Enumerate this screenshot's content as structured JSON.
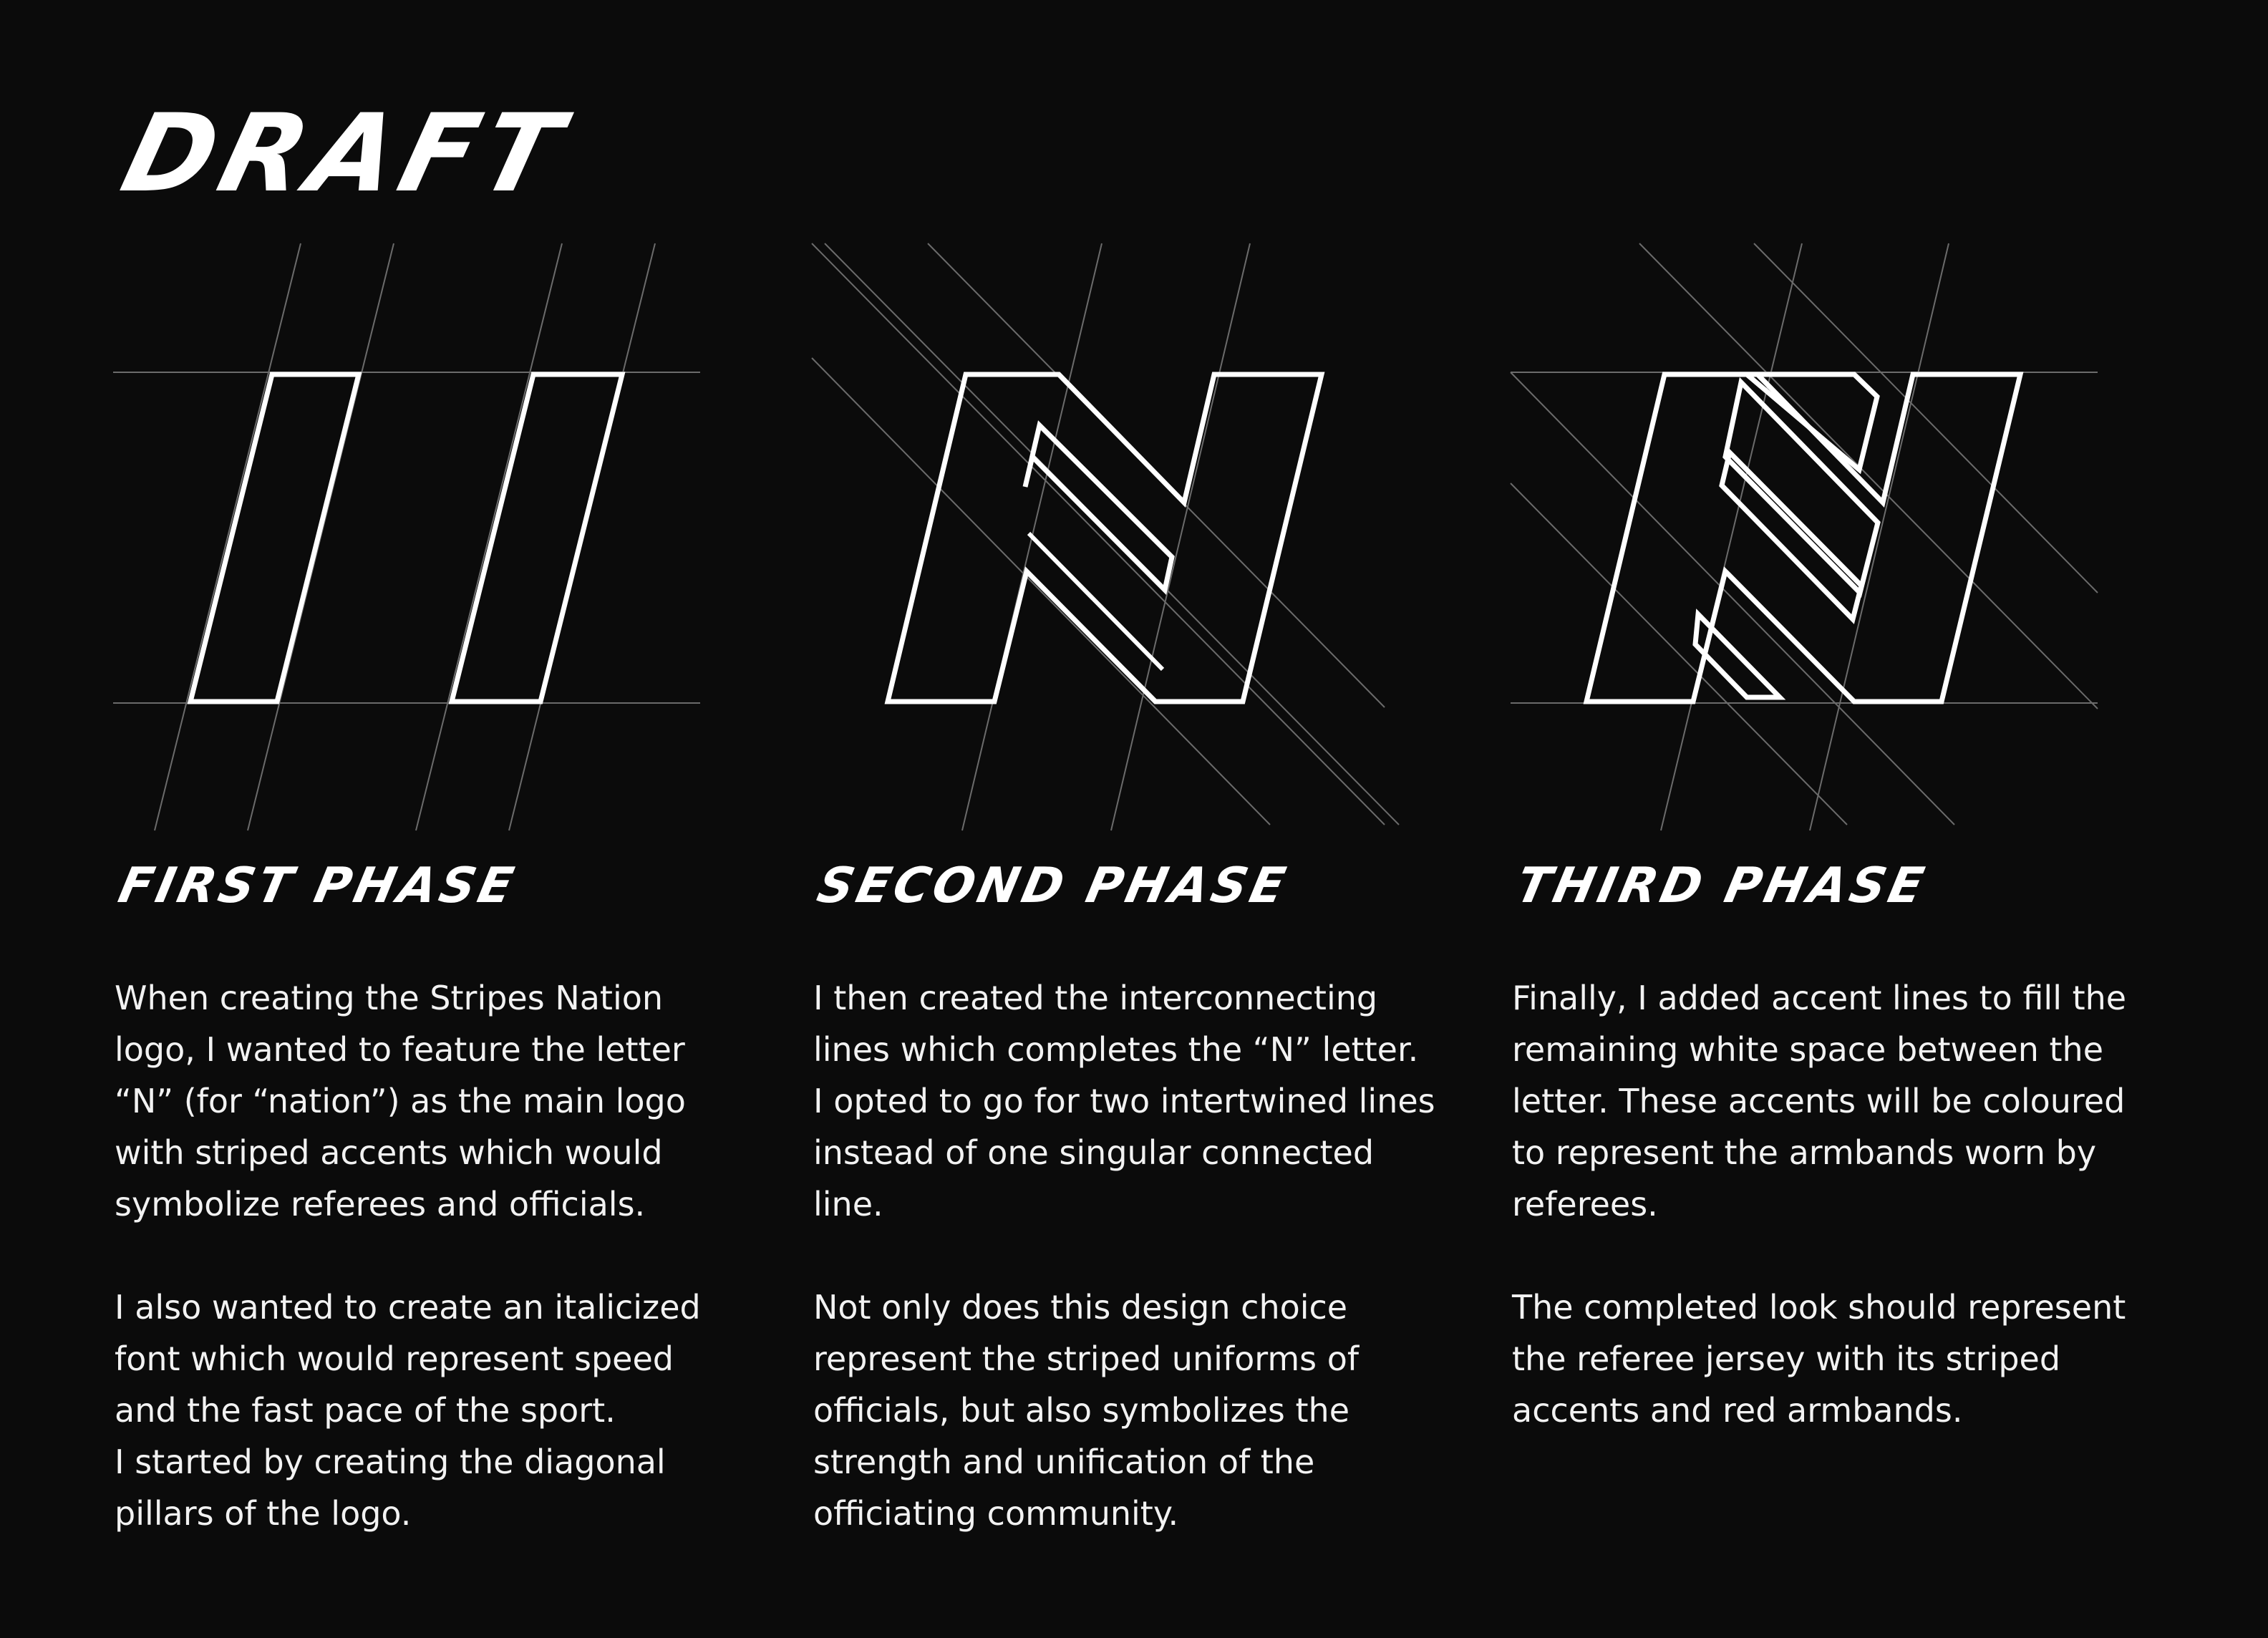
{
  "title": "DRAFT",
  "colors": {
    "background": "#0b0b0b",
    "foreground": "#ffffff",
    "guide": "#6b6b6b"
  },
  "phases": [
    {
      "title": "FIRST PHASE",
      "paragraphs": [
        "When creating the Stripes Nation\nlogo, I wanted to feature the letter\n“N” (for “nation”) as the main logo\nwith striped accents which would\nsymbolize referees and officials.",
        "I also wanted to create an italicized\nfont which would represent speed\nand the fast pace of the sport.\nI started by creating the diagonal\npillars of the logo."
      ]
    },
    {
      "title": "SECOND PHASE",
      "paragraphs": [
        "I then created the interconnecting\nlines which completes the “N” letter.\nI opted to go for two intertwined lines\ninstead of one singular connected\nline.",
        "Not only does this design choice\nrepresent the striped uniforms of\nofficials, but also symbolizes the\nstrength and unification of the\nofficiating community."
      ]
    },
    {
      "title": "THIRD PHASE",
      "paragraphs": [
        "Finally, I added accent lines to fill the\nremaining white space between the\nletter. These accents will be coloured\nto represent the armbands worn by\nreferees.",
        "The completed look should represent\nthe referee jersey with its striped\naccents and red armbands."
      ]
    }
  ]
}
